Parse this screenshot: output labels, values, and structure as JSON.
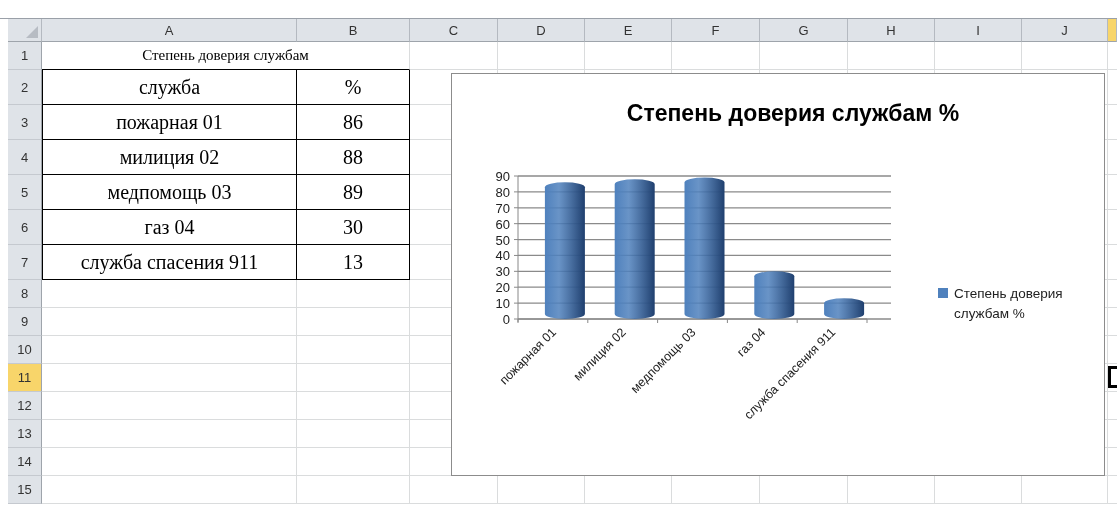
{
  "columns": [
    {
      "label": "A",
      "selected": false
    },
    {
      "label": "B",
      "selected": false
    },
    {
      "label": "C",
      "selected": false
    },
    {
      "label": "D",
      "selected": false
    },
    {
      "label": "E",
      "selected": false
    },
    {
      "label": "F",
      "selected": false
    },
    {
      "label": "G",
      "selected": false
    },
    {
      "label": "H",
      "selected": false
    },
    {
      "label": "I",
      "selected": false
    },
    {
      "label": "J",
      "selected": false
    }
  ],
  "cut_column": {
    "selected": true
  },
  "rows": [
    {
      "label": "1",
      "selected": false
    },
    {
      "label": "2",
      "selected": false
    },
    {
      "label": "3",
      "selected": false
    },
    {
      "label": "4",
      "selected": false
    },
    {
      "label": "5",
      "selected": false
    },
    {
      "label": "6",
      "selected": false
    },
    {
      "label": "7",
      "selected": false
    },
    {
      "label": "8",
      "selected": false
    },
    {
      "label": "9",
      "selected": false
    },
    {
      "label": "10",
      "selected": false
    },
    {
      "label": "11",
      "selected": true
    },
    {
      "label": "12",
      "selected": false
    },
    {
      "label": "13",
      "selected": false
    },
    {
      "label": "14",
      "selected": false
    },
    {
      "label": "15",
      "selected": false
    }
  ],
  "title_cell": "Степень доверия службам",
  "table": {
    "header": [
      "служба",
      "%"
    ],
    "rows": [
      [
        "пожарная 01",
        "86"
      ],
      [
        "милиция 02",
        "88"
      ],
      [
        "медпомощь 03",
        "89"
      ],
      [
        "газ 04",
        "30"
      ],
      [
        "служба спасения 911",
        "13"
      ]
    ]
  },
  "chart": {
    "chart_data": {
      "type": "bar",
      "title": "Степень доверия службам %",
      "categories": [
        "пожарная 01",
        "милиция 02",
        "медпомощь 03",
        "газ 04",
        "служба спасения 911"
      ],
      "series": [
        {
          "name": "Степень доверия службам %",
          "color": "#4f81bd",
          "values": [
            86,
            88,
            89,
            30,
            13
          ]
        }
      ],
      "grid": true,
      "ylim": [
        0,
        90
      ],
      "yticks": [
        0,
        10,
        20,
        30,
        40,
        50,
        60,
        70,
        80,
        90
      ]
    }
  }
}
